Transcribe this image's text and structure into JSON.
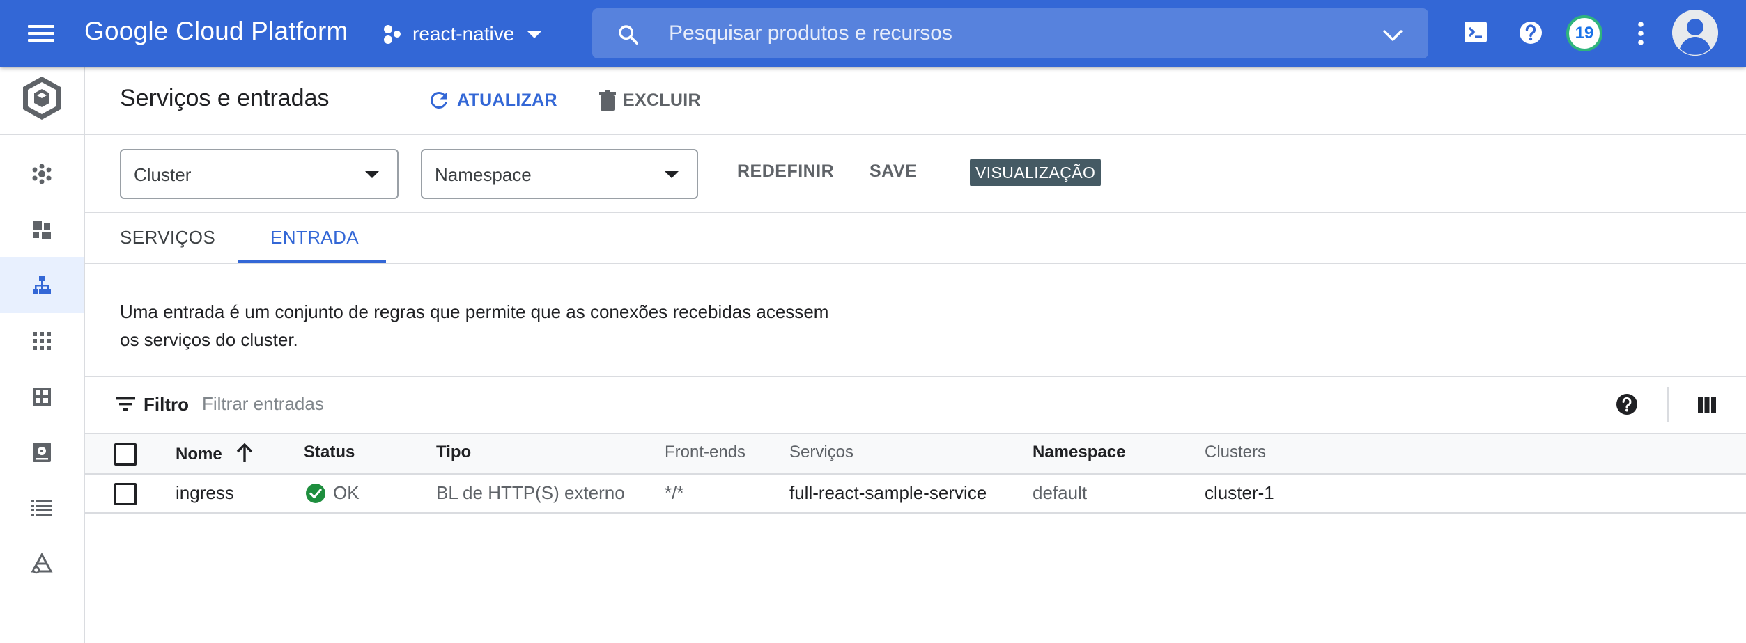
{
  "topbar": {
    "brand": "Google Cloud Platform",
    "project": "react-native",
    "search_placeholder": "Pesquisar produtos e recursos",
    "notification_count": "19",
    "accent": "#3367d6"
  },
  "rail": {
    "items": [
      {
        "icon": "clusters-icon",
        "active": false
      },
      {
        "icon": "workloads-icon",
        "active": false
      },
      {
        "icon": "services-ingress-icon",
        "active": true
      },
      {
        "icon": "applications-icon",
        "active": false
      },
      {
        "icon": "configuration-icon",
        "active": false
      },
      {
        "icon": "storage-icon",
        "active": false
      },
      {
        "icon": "object-browser-icon",
        "active": false
      },
      {
        "icon": "marketplace-icon",
        "active": false
      }
    ]
  },
  "header": {
    "title": "Serviços e entradas",
    "refresh_label": "ATUALIZAR",
    "delete_label": "EXCLUIR"
  },
  "filters": {
    "cluster_select": "Cluster",
    "namespace_select": "Namespace",
    "reset_label": "REDEFINIR",
    "save_label": "SAVE",
    "preview_chip": "VISUALIZAÇÃO"
  },
  "tabs": [
    {
      "label": "SERVIÇOS",
      "active": false
    },
    {
      "label": "ENTRADA",
      "active": true
    }
  ],
  "description": {
    "line1": "Uma entrada é um conjunto de regras que permite que as conexões recebidas acessem",
    "line2": "os serviços do cluster."
  },
  "table_filter": {
    "label": "Filtro",
    "placeholder": "Filtrar entradas"
  },
  "table": {
    "columns": [
      "Nome",
      "Status",
      "Tipo",
      "Front-ends",
      "Serviços",
      "Namespace",
      "Clusters"
    ],
    "rows": [
      {
        "name": "ingress",
        "status": "OK",
        "type": "BL de HTTP(S) externo",
        "frontends": "*/*",
        "services": "full-react-sample-service",
        "namespace": "default",
        "clusters": "cluster-1"
      }
    ]
  }
}
